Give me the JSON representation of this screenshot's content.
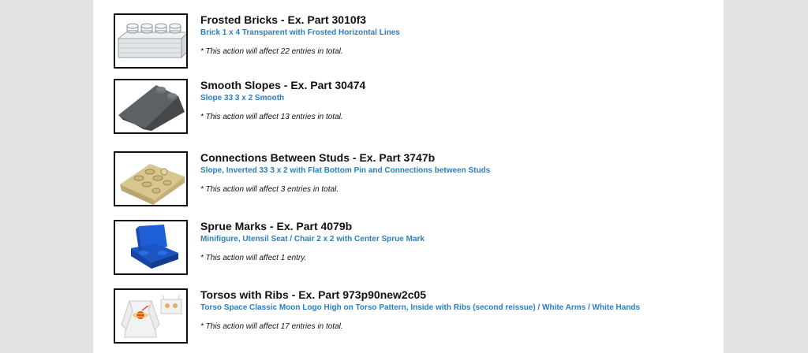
{
  "entries": [
    {
      "title": "Frosted Bricks - Ex. Part 3010f3",
      "subtitle": "Brick 1 x 4 Transparent with Frosted Horizontal Lines",
      "note": "* This action will affect 22 entries in total.",
      "icon": "transparent-brick-icon"
    },
    {
      "title": "Smooth Slopes - Ex. Part 30474",
      "subtitle": "Slope 33 3 x 2 Smooth",
      "note": "* This action will affect 13 entries in total.",
      "icon": "dark-gray-slope-icon"
    },
    {
      "title": "Connections Between Studs - Ex. Part 3747b",
      "subtitle": "Slope, Inverted 33 3 x 2 with Flat Bottom Pin and Connections between Studs",
      "note": "* This action will affect 3 entries in total.",
      "icon": "tan-inverted-slope-icon"
    },
    {
      "title": "Sprue Marks - Ex. Part 4079b",
      "subtitle": "Minifigure, Utensil Seat / Chair 2 x 2 with Center Sprue Mark",
      "note": "* This action will affect 1 entry.",
      "icon": "blue-chair-icon"
    },
    {
      "title": "Torsos with Ribs - Ex. Part 973p90new2c05",
      "subtitle": "Torso Space Classic Moon Logo High on Torso Pattern, Inside with Ribs (second reissue) / White Arms / White Hands",
      "note": "* This action will affect 17 entries in total.",
      "icon": "white-torso-icon"
    }
  ]
}
